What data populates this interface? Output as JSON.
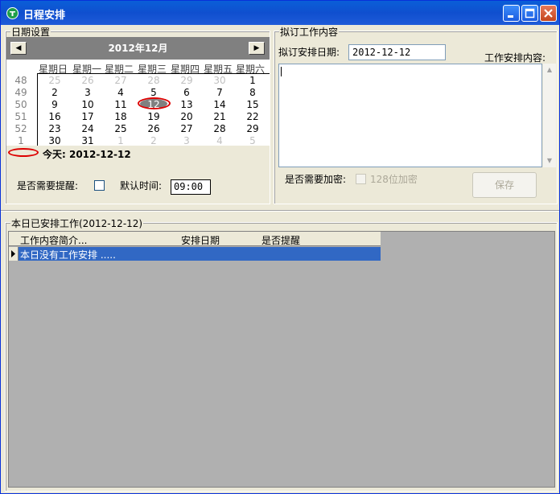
{
  "window": {
    "title": "日程安排"
  },
  "date_settings": {
    "legend": "日期设置",
    "calendar": {
      "month_label": "2012年12月",
      "prev_glyph": "◀",
      "next_glyph": "▶",
      "days_of_week": [
        "星期日",
        "星期一",
        "星期二",
        "星期三",
        "星期四",
        "星期五",
        "星期六"
      ],
      "weeks": [
        {
          "wk": "48",
          "days": [
            {
              "d": "25",
              "other": true
            },
            {
              "d": "26",
              "other": true
            },
            {
              "d": "27",
              "other": true
            },
            {
              "d": "28",
              "other": true
            },
            {
              "d": "29",
              "other": true
            },
            {
              "d": "30",
              "other": true
            },
            {
              "d": "1",
              "other": false
            }
          ]
        },
        {
          "wk": "49",
          "days": [
            {
              "d": "2",
              "other": false
            },
            {
              "d": "3",
              "other": false
            },
            {
              "d": "4",
              "other": false
            },
            {
              "d": "5",
              "other": false
            },
            {
              "d": "6",
              "other": false
            },
            {
              "d": "7",
              "other": false
            },
            {
              "d": "8",
              "other": false
            }
          ]
        },
        {
          "wk": "50",
          "days": [
            {
              "d": "9",
              "other": false
            },
            {
              "d": "10",
              "other": false
            },
            {
              "d": "11",
              "other": false
            },
            {
              "d": "12",
              "other": false
            },
            {
              "d": "13",
              "other": false
            },
            {
              "d": "14",
              "other": false
            },
            {
              "d": "15",
              "other": false
            }
          ]
        },
        {
          "wk": "51",
          "days": [
            {
              "d": "16",
              "other": false
            },
            {
              "d": "17",
              "other": false
            },
            {
              "d": "18",
              "other": false
            },
            {
              "d": "19",
              "other": false
            },
            {
              "d": "20",
              "other": false
            },
            {
              "d": "21",
              "other": false
            },
            {
              "d": "22",
              "other": false
            }
          ]
        },
        {
          "wk": "52",
          "days": [
            {
              "d": "23",
              "other": false
            },
            {
              "d": "24",
              "other": false
            },
            {
              "d": "25",
              "other": false
            },
            {
              "d": "26",
              "other": false
            },
            {
              "d": "27",
              "other": false
            },
            {
              "d": "28",
              "other": false
            },
            {
              "d": "29",
              "other": false
            }
          ]
        },
        {
          "wk": "1",
          "days": [
            {
              "d": "30",
              "other": false
            },
            {
              "d": "31",
              "other": false
            },
            {
              "d": "1",
              "other": true
            },
            {
              "d": "2",
              "other": true
            },
            {
              "d": "3",
              "other": true
            },
            {
              "d": "4",
              "other": true
            },
            {
              "d": "5",
              "other": true
            }
          ]
        }
      ],
      "selected_day": "12",
      "today_label": "今天: 2012-12-12"
    },
    "reminder_label": "是否需要提醒:",
    "reminder_checked": false,
    "default_time_label": "默认时间:",
    "default_time_value": "09:00"
  },
  "draft": {
    "legend": "拟订工作内容",
    "date_label": "拟订安排日期:",
    "date_value": "2012-12-12",
    "content_label": "工作安排内容:",
    "encrypt_label": "是否需要加密:",
    "encrypt_option": "128位加密",
    "save_label": "保存"
  },
  "scheduled": {
    "legend": "本日已安排工作(2012-12-12)",
    "columns": [
      "工作内容简介...",
      "安排日期",
      "是否提醒"
    ],
    "rows": [
      {
        "summary": "本日没有工作安排 ....."
      }
    ]
  }
}
